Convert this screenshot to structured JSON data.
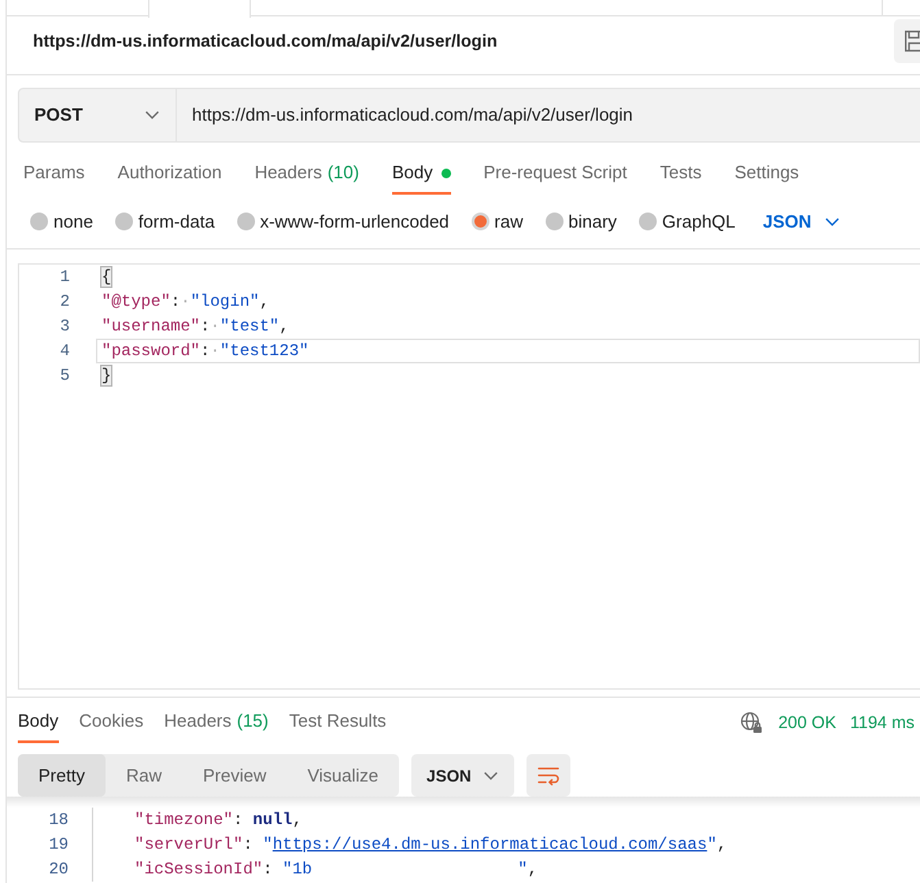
{
  "request": {
    "title": "https://dm-us.informaticacloud.com/ma/api/v2/user/login",
    "method": "POST",
    "url": "https://dm-us.informaticacloud.com/ma/api/v2/user/login"
  },
  "request_tabs": [
    {
      "label": "Params",
      "selected": false,
      "dot": false
    },
    {
      "label": "Authorization",
      "selected": false,
      "dot": false
    },
    {
      "label": "Headers",
      "count": "(10)",
      "selected": false,
      "dot": false
    },
    {
      "label": "Body",
      "selected": true,
      "dot": true
    },
    {
      "label": "Pre-request Script",
      "selected": false,
      "dot": false
    },
    {
      "label": "Tests",
      "selected": false,
      "dot": false
    },
    {
      "label": "Settings",
      "selected": false,
      "dot": false
    }
  ],
  "body_types": [
    {
      "label": "none",
      "selected": false
    },
    {
      "label": "form-data",
      "selected": false
    },
    {
      "label": "x-www-form-urlencoded",
      "selected": false
    },
    {
      "label": "raw",
      "selected": true
    },
    {
      "label": "binary",
      "selected": false
    },
    {
      "label": "GraphQL",
      "selected": false
    }
  ],
  "body_language": "JSON",
  "editor": {
    "lines": [
      {
        "number": "1",
        "active": false,
        "tokens": [
          {
            "kind": "bracket-match",
            "text": "{"
          }
        ]
      },
      {
        "number": "2",
        "active": false,
        "tokens": [
          {
            "kind": "key",
            "text": "\"@type\""
          },
          {
            "kind": "punct",
            "text": ":"
          },
          {
            "kind": "space-marker",
            "text": "·"
          },
          {
            "kind": "string",
            "text": "\"login\""
          },
          {
            "kind": "punct",
            "text": ","
          }
        ]
      },
      {
        "number": "3",
        "active": false,
        "tokens": [
          {
            "kind": "key",
            "text": "\"username\""
          },
          {
            "kind": "punct",
            "text": ":"
          },
          {
            "kind": "space-marker",
            "text": "·"
          },
          {
            "kind": "string",
            "text": "\"test\""
          },
          {
            "kind": "punct",
            "text": ","
          }
        ]
      },
      {
        "number": "4",
        "active": true,
        "tokens": [
          {
            "kind": "key",
            "text": "\"password\""
          },
          {
            "kind": "punct",
            "text": ":"
          },
          {
            "kind": "space-marker",
            "text": "·"
          },
          {
            "kind": "string",
            "text": "\"test123\""
          }
        ]
      },
      {
        "number": "5",
        "active": false,
        "tokens": [
          {
            "kind": "bracket-match",
            "text": "}"
          }
        ]
      }
    ]
  },
  "response": {
    "tabs": [
      {
        "label": "Body",
        "selected": true
      },
      {
        "label": "Cookies",
        "selected": false
      },
      {
        "label": "Headers",
        "count": "(15)",
        "selected": false
      },
      {
        "label": "Test Results",
        "selected": false
      }
    ],
    "status": "200 OK",
    "time": "1194 ms",
    "views": [
      {
        "label": "Pretty",
        "selected": true
      },
      {
        "label": "Raw",
        "selected": false
      },
      {
        "label": "Preview",
        "selected": false
      },
      {
        "label": "Visualize",
        "selected": false
      }
    ],
    "format": "JSON",
    "lines": [
      {
        "number": "18",
        "tokens": [
          {
            "kind": "key",
            "text": "\"timezone\""
          },
          {
            "kind": "punct",
            "text": ": "
          },
          {
            "kind": "keyword",
            "text": "null"
          },
          {
            "kind": "punct",
            "text": ","
          }
        ]
      },
      {
        "number": "19",
        "tokens": [
          {
            "kind": "key",
            "text": "\"serverUrl\""
          },
          {
            "kind": "punct",
            "text": ": "
          },
          {
            "kind": "string",
            "text": "\""
          },
          {
            "kind": "link",
            "text": "https://use4.dm-us.informaticacloud.com/saas"
          },
          {
            "kind": "string",
            "text": "\""
          },
          {
            "kind": "punct",
            "text": ","
          }
        ]
      },
      {
        "number": "20",
        "tokens": [
          {
            "kind": "key",
            "text": "\"icSessionId\""
          },
          {
            "kind": "punct",
            "text": ": "
          },
          {
            "kind": "string",
            "text": "\"1b"
          },
          {
            "kind": "redacted"
          },
          {
            "kind": "string",
            "text": "\""
          },
          {
            "kind": "punct",
            "text": ","
          }
        ]
      }
    ]
  }
}
